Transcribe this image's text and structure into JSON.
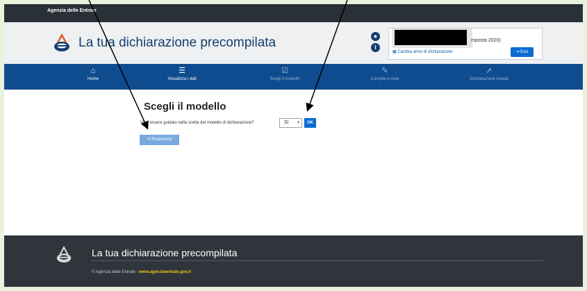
{
  "topbar": {
    "agency": "Agenzia delle Entrate"
  },
  "header": {
    "app_title": "La tua dichiarazione precompilata",
    "user": {
      "tax_year_suffix": "mposta 2020)",
      "change_year": "Cambia anno di dichiarazione",
      "exit_label": "Esci"
    },
    "icons": [
      "account-icon",
      "info-icon"
    ]
  },
  "nav": {
    "items": [
      {
        "label": "Home",
        "icon": "home-icon",
        "enabled": true
      },
      {
        "label": "Visualizza i dati",
        "icon": "list-icon",
        "enabled": true
      },
      {
        "label": "Scegli il modello",
        "icon": "checkbox-icon",
        "enabled": false
      },
      {
        "label": "Compila e invia",
        "icon": "edit-icon",
        "enabled": false
      },
      {
        "label": "Dichiarazione inviata",
        "icon": "send-icon",
        "enabled": false
      }
    ]
  },
  "main": {
    "title": "Scegli il modello",
    "question": "Vuoi essere guidato nella scelta del modello di dichiarazione?",
    "select_value": "Sì",
    "ok_label": "OK",
    "restart_label": "Ricomincia"
  },
  "footer": {
    "title": "La tua dichiarazione precompilata",
    "copyright": "© Agenzia delle Entrate -",
    "site_link": "www.agenziaentrate.gov.it"
  },
  "colors": {
    "nav": "#0f4c8f",
    "accent": "#0b6bd3",
    "footer": "#30353b",
    "page_border": "#e8f2dc"
  }
}
